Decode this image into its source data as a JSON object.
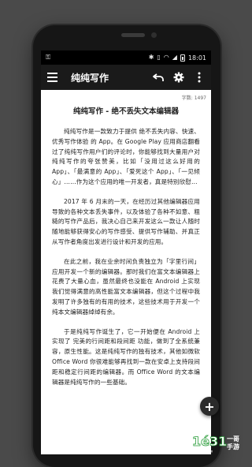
{
  "status_bar": {
    "time": "18:01"
  },
  "toolbar": {
    "title": "纯纯写作"
  },
  "editor": {
    "word_count": "字数: 1497",
    "doc_title": "纯纯写作 - 绝不丢失文本编辑器",
    "paragraphs": [
      "纯纯写作是一款致力于提供 绝不丢失内容、快速、优秀写作体验 的 App。在 Google Play 应用商店翻看过了纯纯写作用户们的评论时，你能够找到大量用户对纯纯写作的夸张赞美，比如「没用过这么好用的 App」、「最满意的 App」、「爱死这个 App」、「一见倾心」……作为这个应用的唯一开发者，真是特别欣慰…",
      "2017 年 6 月末的一天，在经历过其他编辑器应用导致的各种文本丢失事件，以及体验了各种不如意、粗糙的写作产品后，我决心自己来开发这么一款让人随时随地能够获得安心的写作感受、提供写作辅助、并真正从写作者角度出发进行设计和开发的应用。",
      "在此之前，我在业余时间负责独立为「字里行间」应用开发一个新的编辑器。那时我们在富文本编辑器上花费了大量心血，虽然最终也没能在 Android 上实现我们觉得满意的高性能富文本编辑器，但这个过程中我发明了许多独有的有用的技术，这些技术用于开发一个纯本文编辑器绰绰有余。",
      "于是纯纯写作诞生了，它一开始便在 Android 上实现了 完美的行间距和段间距 功能，做到了全系统兼容，原生性能。这是纯纯写作的独有技术，其他如微软 Office Word 你很难能够再找到一款在安卓上支持段间距和稳定行间距的编辑器。而 Office Word 的文本编辑器是纯纯写作的一些基础。"
    ]
  },
  "fab": {
    "label": "+"
  },
  "watermark": {
    "text": "1é31",
    "subtext": "一哥手游 1e31.com"
  },
  "colors": {
    "toolbar_bg": "#1a1a1a",
    "statusbar_bg": "#000000",
    "page_bg": "#4a4a4a"
  }
}
